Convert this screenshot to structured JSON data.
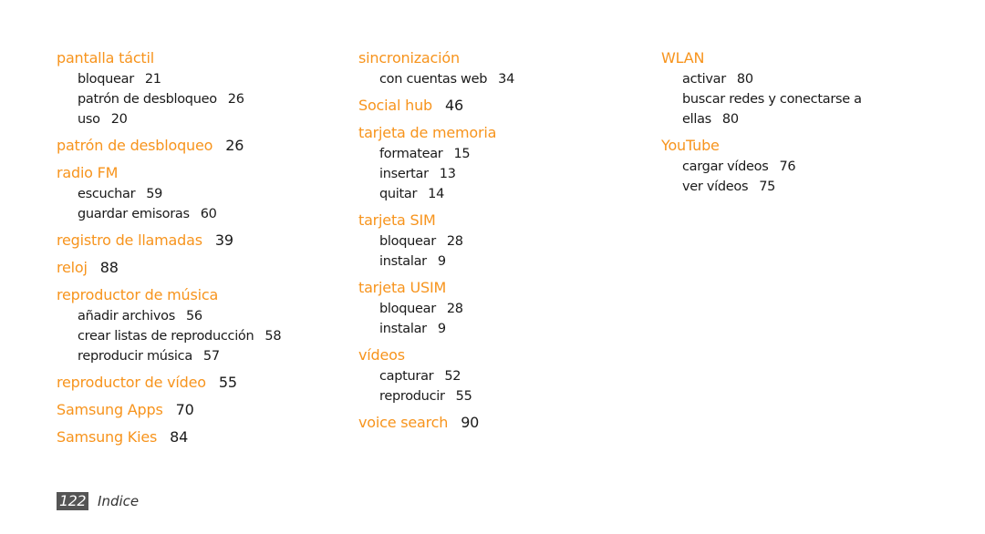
{
  "accent_color": "#f7941d",
  "columns": [
    {
      "entries": [
        {
          "term": "pantalla táctil",
          "page": "",
          "subs": [
            {
              "term": "bloquear",
              "page": "21"
            },
            {
              "term": "patrón de desbloqueo",
              "page": "26"
            },
            {
              "term": "uso",
              "page": "20"
            }
          ]
        },
        {
          "term": "patrón de desbloqueo",
          "page": "26",
          "subs": []
        },
        {
          "term": "radio FM",
          "page": "",
          "subs": [
            {
              "term": "escuchar",
              "page": "59"
            },
            {
              "term": "guardar emisoras",
              "page": "60"
            }
          ]
        },
        {
          "term": "registro de llamadas",
          "page": "39",
          "subs": []
        },
        {
          "term": "reloj",
          "page": "88",
          "subs": []
        },
        {
          "term": "reproductor de música",
          "page": "",
          "subs": [
            {
              "term": "añadir archivos",
              "page": "56"
            },
            {
              "term": "crear listas de reproducción",
              "page": "58"
            },
            {
              "term": "reproducir música",
              "page": "57"
            }
          ]
        },
        {
          "term": "reproductor de vídeo",
          "page": "55",
          "subs": []
        },
        {
          "term": "Samsung Apps",
          "page": "70",
          "subs": []
        },
        {
          "term": "Samsung Kies",
          "page": "84",
          "subs": []
        }
      ]
    },
    {
      "entries": [
        {
          "term": "sincronización",
          "page": "",
          "subs": [
            {
              "term": "con cuentas web",
              "page": "34"
            }
          ]
        },
        {
          "term": "Social hub",
          "page": "46",
          "subs": []
        },
        {
          "term": "tarjeta de memoria",
          "page": "",
          "subs": [
            {
              "term": "formatear",
              "page": "15"
            },
            {
              "term": "insertar",
              "page": "13"
            },
            {
              "term": "quitar",
              "page": "14"
            }
          ]
        },
        {
          "term": "tarjeta SIM",
          "page": "",
          "subs": [
            {
              "term": "bloquear",
              "page": "28"
            },
            {
              "term": "instalar",
              "page": "9"
            }
          ]
        },
        {
          "term": "tarjeta USIM",
          "page": "",
          "subs": [
            {
              "term": "bloquear",
              "page": "28"
            },
            {
              "term": "instalar",
              "page": "9"
            }
          ]
        },
        {
          "term": "vídeos",
          "page": "",
          "subs": [
            {
              "term": "capturar",
              "page": "52"
            },
            {
              "term": "reproducir",
              "page": "55"
            }
          ]
        },
        {
          "term": "voice search",
          "page": "90",
          "subs": []
        }
      ]
    },
    {
      "entries": [
        {
          "term": "WLAN",
          "page": "",
          "subs": [
            {
              "term": "activar",
              "page": "80"
            },
            {
              "term": "buscar redes y conectarse a ellas",
              "page": "80"
            }
          ]
        },
        {
          "term": "YouTube",
          "page": "",
          "subs": [
            {
              "term": "cargar vídeos",
              "page": "76"
            },
            {
              "term": "ver vídeos",
              "page": "75"
            }
          ]
        }
      ]
    }
  ],
  "footer": {
    "page_number": "122",
    "section": "Indice"
  }
}
